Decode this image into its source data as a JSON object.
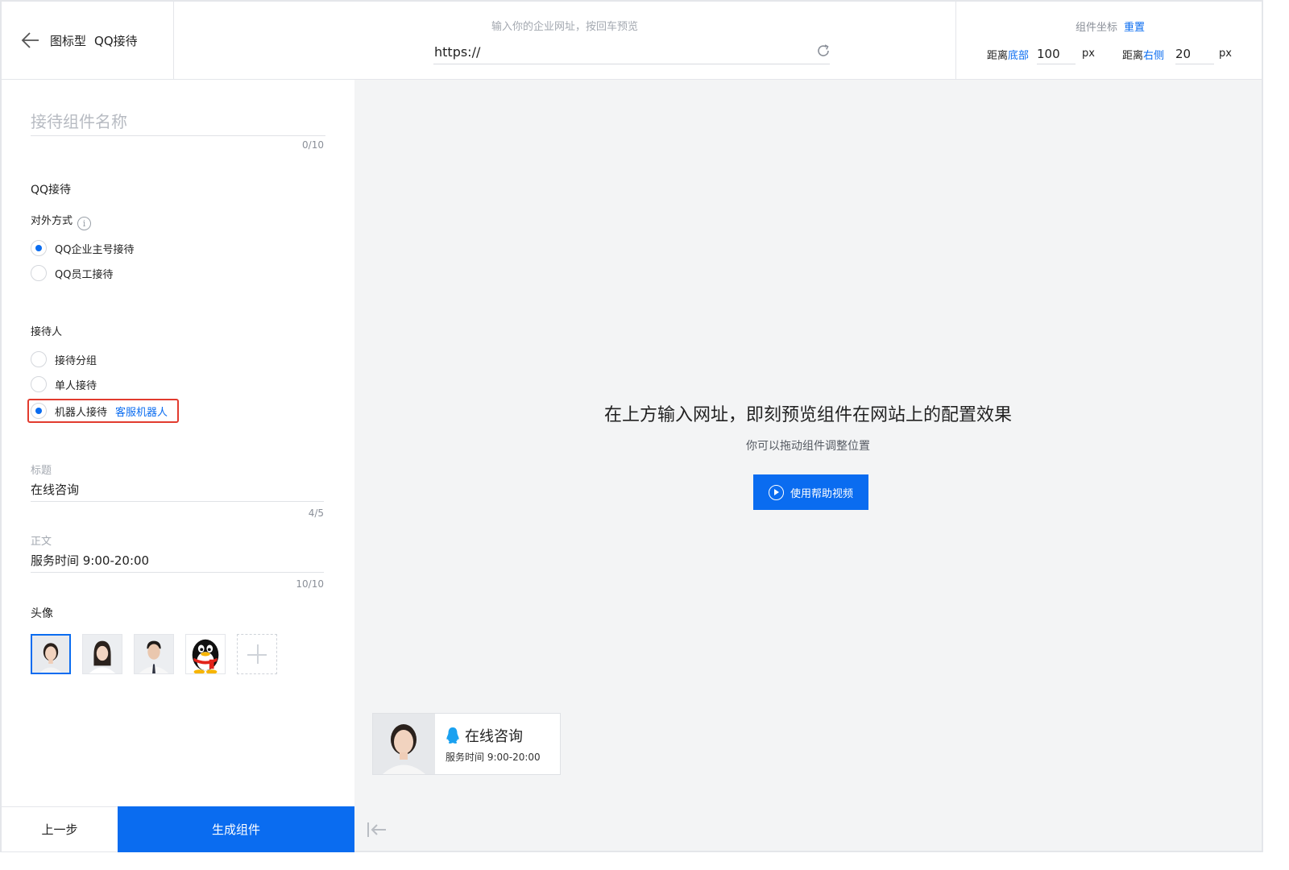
{
  "header": {
    "breadcrumb": [
      "图标型",
      "QQ接待"
    ],
    "url_hint": "输入你的企业网址，按回车预览",
    "url_value": "https://",
    "coord_title": "组件坐标",
    "reset_label": "重置",
    "bottom_prefix": "距离",
    "bottom_word": "底部",
    "bottom_value": "100",
    "right_prefix": "距离",
    "right_word": "右侧",
    "right_value": "20",
    "unit": "px"
  },
  "form": {
    "name_placeholder": "接待组件名称",
    "name_counter": "0/10",
    "section_title": "QQ接待",
    "contact_label": "对外方式",
    "contact_options": [
      {
        "label": "QQ企业主号接待",
        "checked": true
      },
      {
        "label": "QQ员工接待",
        "checked": false
      }
    ],
    "receiver_label": "接待人",
    "receiver_options": [
      {
        "label": "接待分组",
        "checked": false
      },
      {
        "label": "单人接待",
        "checked": false
      },
      {
        "label": "机器人接待",
        "checked": true,
        "link": "客服机器人"
      }
    ],
    "title_caption": "标题",
    "title_value": "在线咨询",
    "title_counter": "4/5",
    "body_caption": "正文",
    "body_value": "服务时间 9:00-20:00",
    "body_counter": "10/10",
    "avatar_label": "头像",
    "avatars": [
      "female-avatar-1",
      "female-avatar-2",
      "male-avatar",
      "qq-penguin-avatar"
    ]
  },
  "footer": {
    "prev_label": "上一步",
    "generate_label": "生成组件"
  },
  "preview": {
    "title": "在上方输入网址，即刻预览组件在网站上的配置效果",
    "subtitle": "你可以拖动组件调整位置",
    "help_button": "使用帮助视频",
    "widget_title": "在线咨询",
    "widget_text": "服务时间 9:00-20:00"
  },
  "colors": {
    "accent": "#0a6cf0",
    "highlight": "#e23b2e",
    "preview_bg": "#f3f4f5"
  }
}
